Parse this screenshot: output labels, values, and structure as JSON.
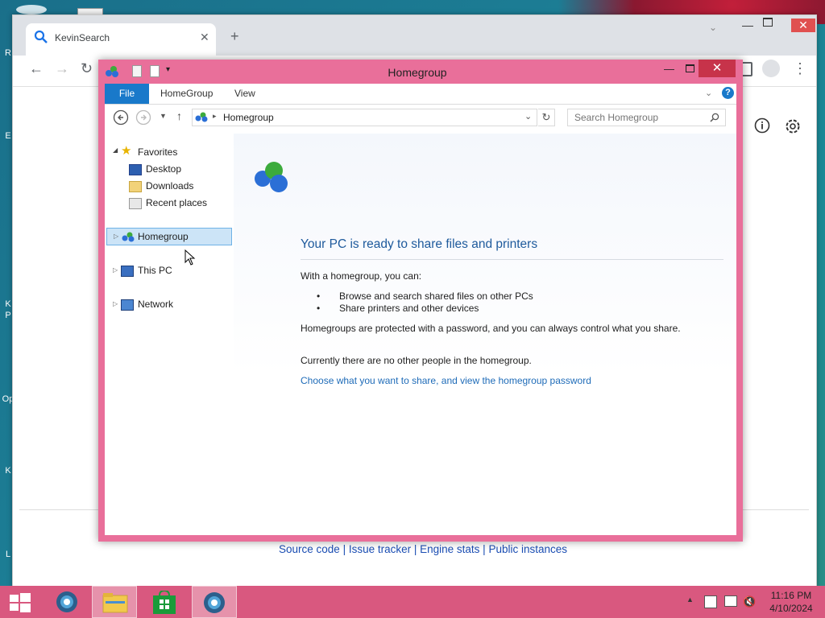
{
  "desktop": {
    "edge_labels": [
      "R",
      "E",
      "K",
      "P",
      "Op",
      "K",
      "L"
    ]
  },
  "browser": {
    "tab_title": "KevinSearch",
    "tab_close": "✕",
    "new_tab": "+",
    "footer": {
      "source_code": "Source code",
      "issue_tracker": "Issue tracker",
      "engine_stats": "Engine stats",
      "public_instances": "Public instances",
      "separator": " | "
    }
  },
  "explorer": {
    "title": "Homegroup",
    "ribbon": {
      "file": "File",
      "homegroup": "HomeGroup",
      "view": "View"
    },
    "address": "Homegroup",
    "search_placeholder": "Search Homegroup",
    "nav": {
      "favorites": "Favorites",
      "desktop": "Desktop",
      "downloads": "Downloads",
      "recent_places": "Recent places",
      "homegroup": "Homegroup",
      "this_pc": "This PC",
      "network": "Network"
    },
    "content": {
      "heading": "Your PC is ready to share files and printers",
      "intro": "With a homegroup, you can:",
      "bullets": [
        "Browse and search shared files on other PCs",
        "Share printers and other devices"
      ],
      "protected": "Homegroups are protected with a password, and you can always control what you share.",
      "no_people": "Currently there are no other people in the homegroup.",
      "link": "Choose what you want to share, and view the homegroup password"
    }
  },
  "taskbar": {
    "time": "11:16 PM",
    "date": "4/10/2024"
  },
  "colors": {
    "window_frame": "#e96f9a",
    "taskbar": "#d9587f",
    "file_tab": "#1979ca",
    "link": "#1e6bb8",
    "heading": "#1e5a9c"
  }
}
